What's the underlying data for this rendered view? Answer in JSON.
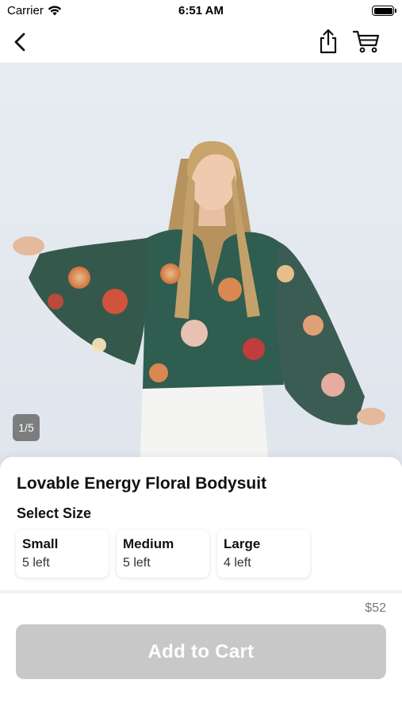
{
  "status_bar": {
    "carrier": "Carrier",
    "time": "6:51 AM"
  },
  "nav": {
    "back_icon": "chevron-left-icon",
    "share_icon": "share-icon",
    "cart_icon": "cart-icon"
  },
  "gallery": {
    "counter": "1/5"
  },
  "product": {
    "title": "Lovable Energy Floral Bodysuit",
    "select_size_label": "Select Size",
    "sizes": [
      {
        "name": "Small",
        "stock": "5 left"
      },
      {
        "name": "Medium",
        "stock": "5 left"
      },
      {
        "name": "Large",
        "stock": "4 left"
      }
    ],
    "price": "$52"
  },
  "actions": {
    "add_to_cart_label": "Add to Cart"
  },
  "colors": {
    "disabled_button": "#c8c8c8",
    "price_text": "#777777"
  }
}
